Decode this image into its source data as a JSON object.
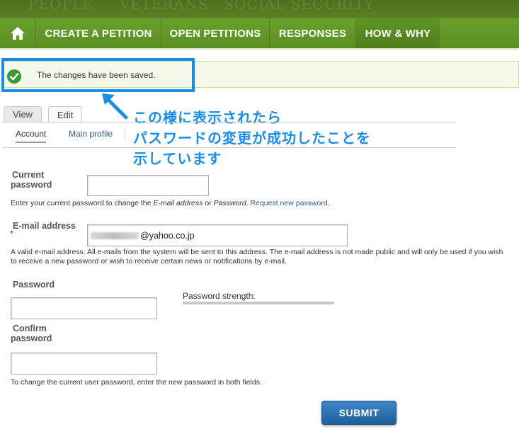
{
  "nav": {
    "items": [
      {
        "label": "CREATE A PETITION"
      },
      {
        "label": "OPEN PETITIONS"
      },
      {
        "label": "RESPONSES"
      },
      {
        "label": "HOW & WHY"
      }
    ],
    "home_icon": "home-icon"
  },
  "status": {
    "message": "The changes have been saved.",
    "icon": "check-circle-icon",
    "color": "#3a9a32"
  },
  "annotation": {
    "lines": [
      "この様に表示されたら",
      "パスワードの変更が成功したことを",
      "示しています"
    ],
    "color": "#1a8de6"
  },
  "tabs": {
    "primary": [
      {
        "label": "View"
      },
      {
        "label": "Edit"
      }
    ],
    "secondary": [
      {
        "label": "Account"
      },
      {
        "label": "Main profile"
      }
    ]
  },
  "form": {
    "current_password": {
      "label_line1": "Current",
      "label_line2": "password",
      "value": "",
      "desc_prefix": "Enter your current password to change the ",
      "desc_email": "E-mail address",
      "desc_or": " or ",
      "desc_password": "Password",
      "desc_end": ". ",
      "desc_link": "Request new password",
      "desc_period": "."
    },
    "email": {
      "label": "E-mail address",
      "required_mark": "*",
      "value_suffix": "@yahoo.co.jp",
      "desc": "A valid e-mail address. All e-mails from the system will be sent to this address. The e-mail address is not made public and will only be used if you wish to receive a new password or wish to receive certain news or notifications by e-mail."
    },
    "password": {
      "label": "Password",
      "value": ""
    },
    "strength": {
      "label": "Password strength:"
    },
    "confirm": {
      "label_line1": "Confirm",
      "label_line2": "password",
      "value": "",
      "desc": "To change the current user password, enter the new password in both fields."
    },
    "submit_label": "SUBMIT"
  },
  "colors": {
    "nav_green": "#6aa12c",
    "highlight_blue": "#1a8de6",
    "submit_blue": "#2f72b3"
  }
}
